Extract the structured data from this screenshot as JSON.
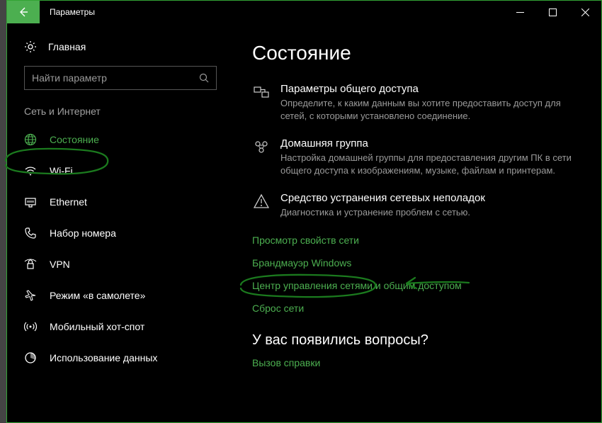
{
  "window": {
    "title": "Параметры"
  },
  "sidebar": {
    "home_label": "Главная",
    "search_placeholder": "Найти параметр",
    "group_header": "Сеть и Интернет",
    "items": [
      {
        "label": "Состояние"
      },
      {
        "label": "Wi-Fi"
      },
      {
        "label": "Ethernet"
      },
      {
        "label": "Набор номера"
      },
      {
        "label": "VPN"
      },
      {
        "label": "Режим «в самолете»"
      },
      {
        "label": "Мобильный хот-спот"
      },
      {
        "label": "Использование данных"
      }
    ]
  },
  "content": {
    "title": "Состояние",
    "cards": [
      {
        "title": "Параметры общего доступа",
        "desc": "Определите, к каким данным вы хотите предоставить доступ для сетей, с которыми установлено соединение."
      },
      {
        "title": "Домашняя группа",
        "desc": "Настройка домашней группы для предоставления другим ПК в сети общего доступа к изображениям, музыке, файлам и принтерам."
      },
      {
        "title": "Средство устранения сетевых неполадок",
        "desc": "Диагностика и устранение проблем с сетью."
      }
    ],
    "links": [
      "Просмотр свойств сети",
      "Брандмауэр Windows",
      "Центр управления сетями и общим доступом",
      "Сброс сети"
    ],
    "question_heading": "У вас появились вопросы?",
    "help_link": "Вызов справки"
  }
}
